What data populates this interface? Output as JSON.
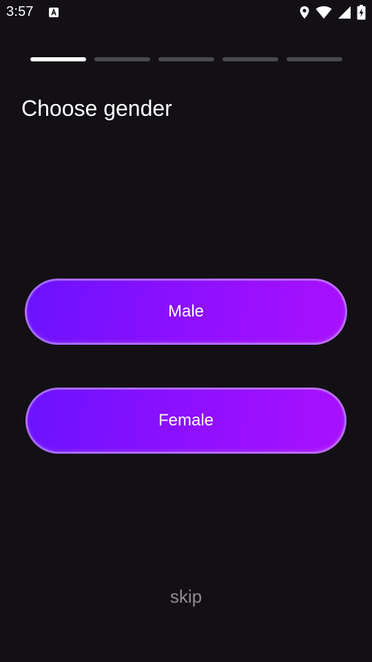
{
  "status_bar": {
    "time": "3:57",
    "icons": [
      "notification-a-icon",
      "location-icon",
      "wifi-icon",
      "signal-icon",
      "battery-charging-icon"
    ]
  },
  "progress": {
    "total_steps": 5,
    "current_step": 1
  },
  "page": {
    "title": "Choose gender"
  },
  "options": {
    "male_label": "Male",
    "female_label": "Female"
  },
  "skip_label": "skip",
  "colors": {
    "background": "#121014",
    "button_gradient_start": "#6a12ff",
    "button_gradient_end": "#a910ff",
    "progress_active": "#ffffff",
    "progress_inactive": "#4a4a4c",
    "skip_text": "#8e8c92"
  }
}
